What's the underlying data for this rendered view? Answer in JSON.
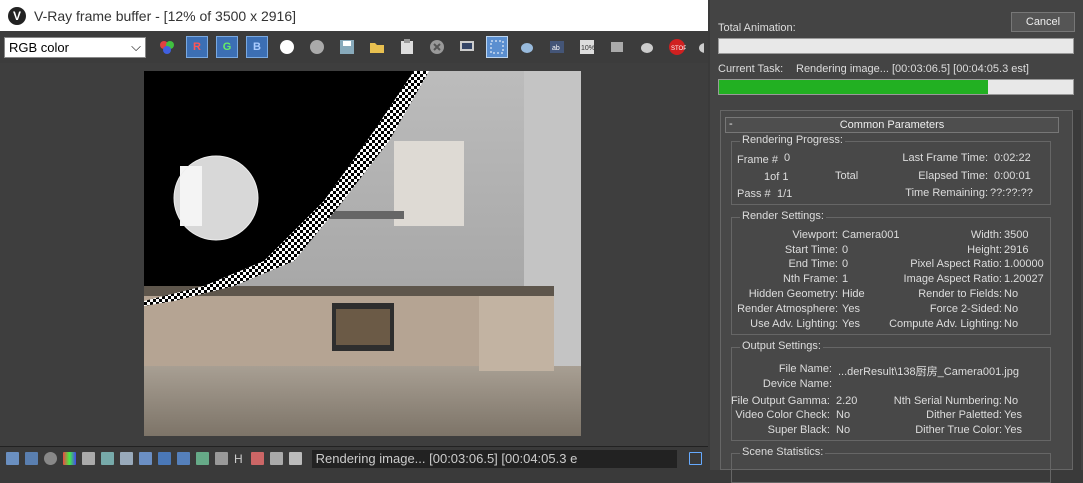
{
  "vfb": {
    "title": "V-Ray frame buffer - [12% of 3500 x 2916]",
    "channel": "RGB color",
    "toolbar": {
      "r": "R",
      "g": "G",
      "b": "B"
    },
    "status_text": "Rendering image... [00:03:06.5] [00:04:05.3 est]",
    "status_h": "H"
  },
  "panel": {
    "total_animation_label": "Total Animation:",
    "cancel_label": "Cancel",
    "current_task_label": "Current Task:",
    "current_task_value": "Rendering image... [00:03:06.5] [00:04:05.3 est]",
    "total_progress": 0,
    "task_progress": 0.76,
    "common_parameters": "Common Parameters",
    "minus": "-",
    "rendering_progress": {
      "title": "Rendering Progress:",
      "frame_label": "Frame #",
      "frame_value": "0",
      "of_label": "1of 1",
      "total_label": "Total",
      "pass_label": "Pass #",
      "pass_value": "1/1",
      "last_frame_time_label": "Last Frame Time:",
      "last_frame_time": "0:02:22",
      "elapsed_label": "Elapsed Time:",
      "elapsed": "0:00:01",
      "remaining_label": "Time Remaining:",
      "remaining": "??:??:??"
    },
    "render_settings": {
      "title": "Render Settings:",
      "viewport_label": "Viewport:",
      "viewport": "Camera001",
      "width_label": "Width:",
      "width": "3500",
      "start_label": "Start Time:",
      "start": "0",
      "height_label": "Height:",
      "height": "2916",
      "end_label": "End Time:",
      "end": "0",
      "par_label": "Pixel Aspect Ratio:",
      "par": "1.00000",
      "nth_label": "Nth Frame:",
      "nth": "1",
      "iar_label": "Image Aspect Ratio:",
      "iar": "1.20027",
      "hidden_label": "Hidden Geometry:",
      "hidden": "Hide",
      "fields_label": "Render to Fields:",
      "fields": "No",
      "atmo_label": "Render Atmosphere:",
      "atmo": "Yes",
      "force_label": "Force 2-Sided:",
      "force": "No",
      "adv_label": "Use Adv. Lighting:",
      "adv": "Yes",
      "compute_label": "Compute Adv. Lighting:",
      "compute": "No"
    },
    "output_settings": {
      "title": "Output Settings:",
      "file_label": "File Name:",
      "file": "...derResult\\138厨房_Camera001.jpg",
      "device_label": "Device Name:",
      "device": "",
      "gamma_label": "File Output Gamma:",
      "gamma": "2.20",
      "serial_label": "Nth Serial Numbering:",
      "serial": "No",
      "video_label": "Video Color Check:",
      "video": "No",
      "dither_p_label": "Dither Paletted:",
      "dither_p": "Yes",
      "super_label": "Super Black:",
      "super": "No",
      "dither_t_label": "Dither True Color:",
      "dither_t": "Yes"
    },
    "scene_statistics": {
      "title": "Scene Statistics:"
    }
  }
}
